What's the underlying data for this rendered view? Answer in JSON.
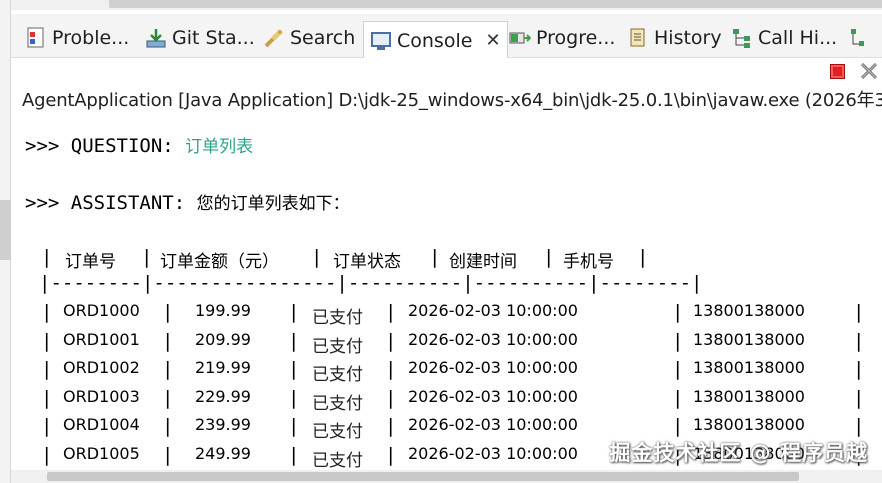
{
  "tabs": [
    {
      "label": "Proble...",
      "icon": "problems-icon",
      "active": false
    },
    {
      "label": "Git Sta...",
      "icon": "git-staging-icon",
      "active": false
    },
    {
      "label": "Search",
      "icon": "search-icon",
      "active": false
    },
    {
      "label": "Console",
      "icon": "console-icon",
      "active": true
    },
    {
      "label": "Progre...",
      "icon": "progress-icon",
      "active": false
    },
    {
      "label": "History",
      "icon": "history-icon",
      "active": false
    },
    {
      "label": "Call Hi...",
      "icon": "call-hierarchy-icon",
      "active": false
    }
  ],
  "toolbar": {
    "terminate_icon": "terminate-icon",
    "remove_icon": "remove-launch-icon"
  },
  "launch_description": "AgentApplication [Java Application] D:\\jdk-25_windows-x64_bin\\jdk-25.0.1\\bin\\javaw.exe  (2026年3",
  "console": {
    "question_label": ">>> QUESTION: ",
    "question_value": "订单列表",
    "assistant_label": ">>> ASSISTANT: ",
    "assistant_value": "您的订单列表如下：",
    "table": {
      "headers": [
        "订单号",
        "订单金额（元）",
        "订单状态",
        "创建时间",
        "手机号"
      ],
      "separator": "|--------|----------------|----------|----------|--------|",
      "rows": [
        [
          "ORD1000",
          "199.99",
          "已支付",
          "2026-02-03 10:00:00",
          "13800138000"
        ],
        [
          "ORD1001",
          "209.99",
          "已支付",
          "2026-02-03 10:00:00",
          "13800138000"
        ],
        [
          "ORD1002",
          "219.99",
          "已支付",
          "2026-02-03 10:00:00",
          "13800138000"
        ],
        [
          "ORD1003",
          "229.99",
          "已支付",
          "2026-02-03 10:00:00",
          "13800138000"
        ],
        [
          "ORD1004",
          "239.99",
          "已支付",
          "2026-02-03 10:00:00",
          "13800138000"
        ],
        [
          "ORD1005",
          "249.99",
          "已支付",
          "2026-02-03 10:00:00",
          "13800138000"
        ]
      ]
    }
  },
  "watermark": "掘金技术社区 @ 程序员越",
  "colors": {
    "question_value": "#2ca589",
    "terminate": "#e02020"
  }
}
